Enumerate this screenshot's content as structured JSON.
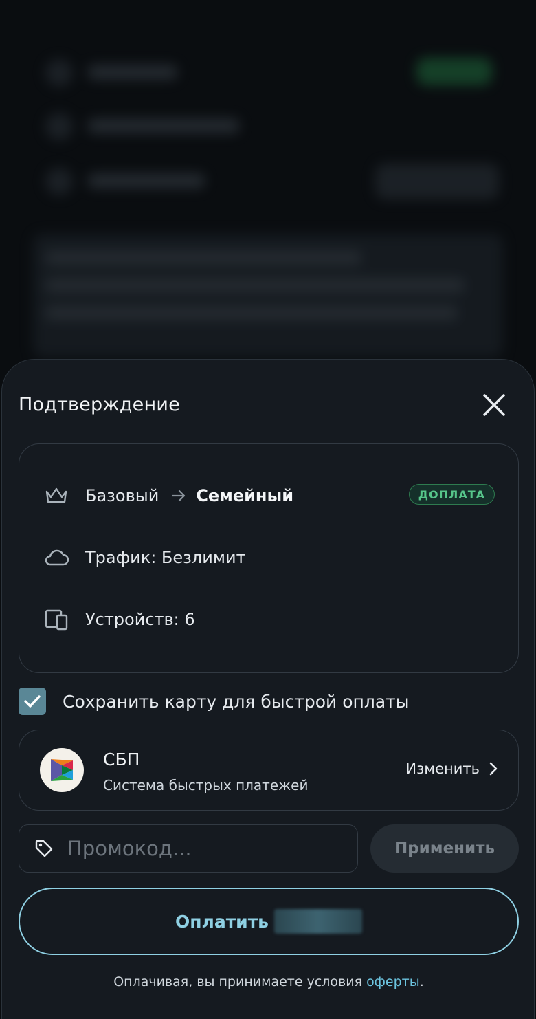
{
  "sheet": {
    "title": "Подтверждение"
  },
  "plan": {
    "from": "Базовый",
    "to": "Семейный",
    "badge": "ДОПЛАТА",
    "traffic": "Трафик: Безлимит",
    "devices": "Устройств: 6"
  },
  "save_card": {
    "label": "Сохранить карту для быстрой оплаты",
    "checked": true
  },
  "payment_method": {
    "name": "СБП",
    "description": "Система быстрых платежей",
    "change_label": "Изменить"
  },
  "promo": {
    "placeholder": "Промокод...",
    "apply_label": "Применить"
  },
  "pay": {
    "label": "Оплатить"
  },
  "footer": {
    "text": "Оплачивая, вы принимаете условия",
    "link": "оферты",
    "end": "."
  },
  "colors": {
    "accent": "#8fd0e3",
    "badge_green": "#56c58a",
    "checkbox": "#5a8796",
    "link": "#6cc4df"
  },
  "icons": {
    "close": "close-icon",
    "crown": "crown-icon",
    "cloud": "cloud-icon",
    "devices": "devices-icon",
    "tag": "tag-icon",
    "chevron": "chevron-right-icon"
  }
}
